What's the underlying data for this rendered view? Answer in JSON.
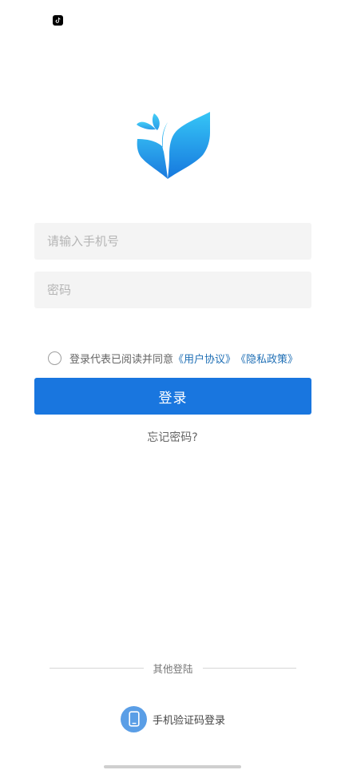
{
  "status_bar": {
    "app_icon": "tiktok-icon"
  },
  "brand": {
    "logo_icon": "leaf-logo-icon",
    "colors": {
      "light": "#35c3f5",
      "dark": "#1976df"
    }
  },
  "form": {
    "phone_placeholder": "请输入手机号",
    "password_placeholder": "密码",
    "agreement_text": "登录代表已阅读并同意",
    "user_agreement_link": "《用户协议》",
    "privacy_link": "《隐私政策》",
    "agreement_checked": false,
    "login_button": "登录",
    "forgot_password": "忘记密码?"
  },
  "other_login": {
    "divider_label": "其他登陆",
    "sms_login_label": "手机验证码登录",
    "sms_icon": "phone-icon"
  },
  "colors": {
    "primary": "#1976df",
    "link": "#1f6fb5",
    "field_bg": "#f4f4f4"
  }
}
